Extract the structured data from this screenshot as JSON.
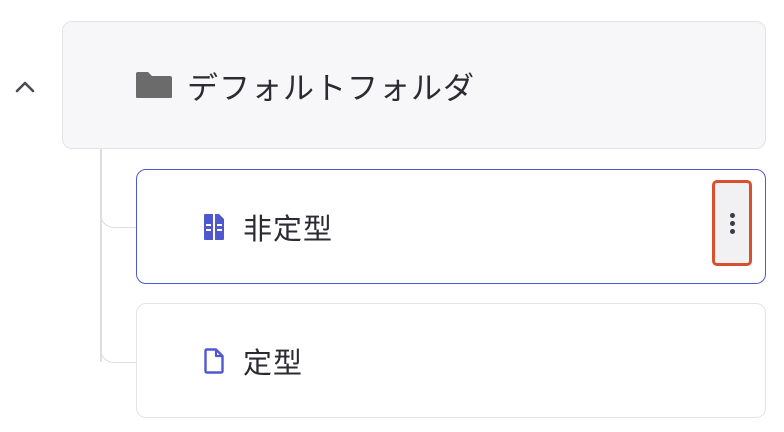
{
  "tree": {
    "folder": {
      "label": "デフォルトフォルダ",
      "icon": "folder-icon",
      "expanded": true,
      "toggle_icon": "chevron-up-icon"
    },
    "items": [
      {
        "label": "非定型",
        "icon": "document-columns-icon",
        "selected": true,
        "menu_icon": "more-vertical-icon"
      },
      {
        "label": "定型",
        "icon": "document-outline-icon",
        "selected": false
      }
    ]
  },
  "colors": {
    "accent": "#5058cf",
    "highlight_border": "#d9502f",
    "folder_icon": "#6b6b6b",
    "text": "#2b2b33"
  }
}
